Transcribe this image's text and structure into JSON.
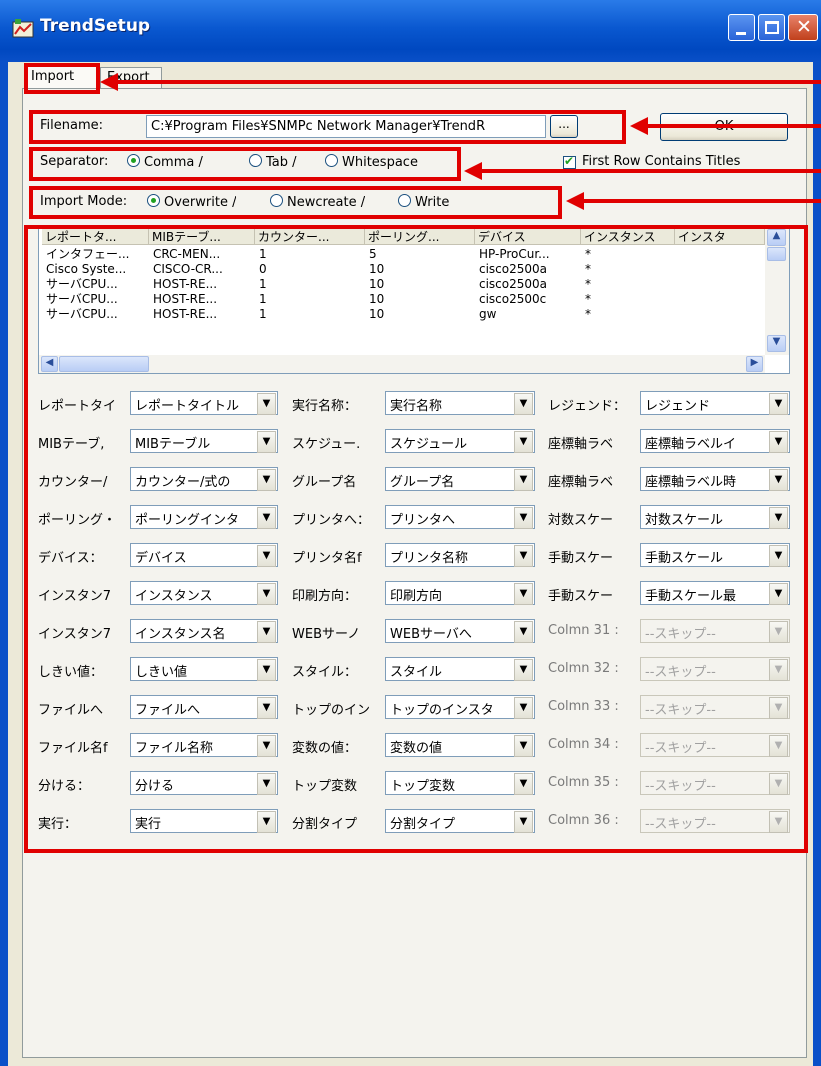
{
  "window": {
    "title": "TrendSetup"
  },
  "tabs": [
    {
      "label": "Import"
    },
    {
      "label": "Export"
    }
  ],
  "import": {
    "filename_label": "Filename:",
    "filename_value": "C:¥Program Files¥SNMPc Network Manager¥TrendR",
    "browse_label": "...",
    "ok_label": "OK",
    "separator_label": "Separator:",
    "separator_options": [
      "Comma /",
      "Tab /",
      "Whitespace"
    ],
    "separator_selected": "Comma",
    "first_row_label": "First Row Contains Titles",
    "first_row_checked": true,
    "mode_label": "Import Mode:",
    "mode_options": [
      "Overwrite /",
      "Newcreate /",
      "Write"
    ],
    "mode_selected": "Overwrite"
  },
  "list": {
    "columns": [
      "レポートタ...",
      "MIBテーブ...",
      "カウンター...",
      "ポーリング...",
      "デバイス",
      "インスタンス",
      "インスタ"
    ],
    "rows": [
      [
        "インタフェー...",
        "CRC-MEN...",
        "1",
        "5",
        "HP-ProCur...",
        "*"
      ],
      [
        "Cisco Syste...",
        "CISCO-CR...",
        "0",
        "10",
        "cisco2500a",
        "*"
      ],
      [
        "サーバCPU...",
        "HOST-RE...",
        "1",
        "10",
        "cisco2500a",
        "*"
      ],
      [
        "サーバCPU...",
        "HOST-RE...",
        "1",
        "10",
        "cisco2500c",
        "*"
      ],
      [
        "サーバCPU...",
        "HOST-RE...",
        "1",
        "10",
        "gw",
        "*"
      ]
    ]
  },
  "fields": {
    "col1": [
      {
        "label": "レポートタイ",
        "value": "レポートタイトル"
      },
      {
        "label": "MIBテーブ,",
        "value": "MIBテーブル"
      },
      {
        "label": "カウンター/",
        "value": "カウンター/式の"
      },
      {
        "label": "ポーリング・",
        "value": "ポーリングインタ"
      },
      {
        "label": "デバイス：",
        "value": "デバイス"
      },
      {
        "label": "インスタン7",
        "value": "インスタンス"
      },
      {
        "label": "インスタン7",
        "value": "インスタンス名"
      },
      {
        "label": "しきい値：",
        "value": "しきい値"
      },
      {
        "label": "ファイルへ",
        "value": "ファイルへ"
      },
      {
        "label": "ファイル名f",
        "value": "ファイル名称"
      },
      {
        "label": "分ける：",
        "value": "分ける"
      },
      {
        "label": "実行：",
        "value": "実行"
      }
    ],
    "col2": [
      {
        "label": "実行名称：",
        "value": "実行名称"
      },
      {
        "label": "スケジュー.",
        "value": "スケジュール"
      },
      {
        "label": "グループ名",
        "value": "グループ名"
      },
      {
        "label": "プリンタへ：",
        "value": "プリンタへ"
      },
      {
        "label": "プリンタ名f",
        "value": "プリンタ名称"
      },
      {
        "label": "印刷方向：",
        "value": "印刷方向"
      },
      {
        "label": "WEBサーノ",
        "value": "WEBサーバへ"
      },
      {
        "label": "スタイル：",
        "value": "スタイル"
      },
      {
        "label": "トップのイン",
        "value": "トップのインスタ"
      },
      {
        "label": "変数の値：",
        "value": "変数の値"
      },
      {
        "label": "トップ変数",
        "value": "トップ変数"
      },
      {
        "label": "分割タイプ",
        "value": "分割タイプ"
      }
    ],
    "col3": [
      {
        "label": "レジェンド：",
        "value": "レジェンド",
        "disabled": false
      },
      {
        "label": "座標軸ラベ",
        "value": "座標軸ラベルイ",
        "disabled": false
      },
      {
        "label": "座標軸ラベ",
        "value": "座標軸ラベル時",
        "disabled": false
      },
      {
        "label": "対数スケー",
        "value": "対数スケール",
        "disabled": false
      },
      {
        "label": "手動スケー",
        "value": "手動スケール",
        "disabled": false
      },
      {
        "label": "手動スケー",
        "value": "手動スケール最",
        "disabled": false
      },
      {
        "label": "Colmn 31 :",
        "value": "--スキップ--",
        "disabled": true
      },
      {
        "label": "Colmn 32 :",
        "value": "--スキップ--",
        "disabled": true
      },
      {
        "label": "Colmn 33 :",
        "value": "--スキップ--",
        "disabled": true
      },
      {
        "label": "Colmn 34 :",
        "value": "--スキップ--",
        "disabled": true
      },
      {
        "label": "Colmn 35 :",
        "value": "--スキップ--",
        "disabled": true
      },
      {
        "label": "Colmn 36 :",
        "value": "--スキップ--",
        "disabled": true
      }
    ]
  },
  "icons": {
    "dropdown": "chevron-down-icon",
    "app": "trend-app-icon"
  },
  "colors": {
    "annotation": "#e00000",
    "titlebar": "#0a58d0"
  }
}
